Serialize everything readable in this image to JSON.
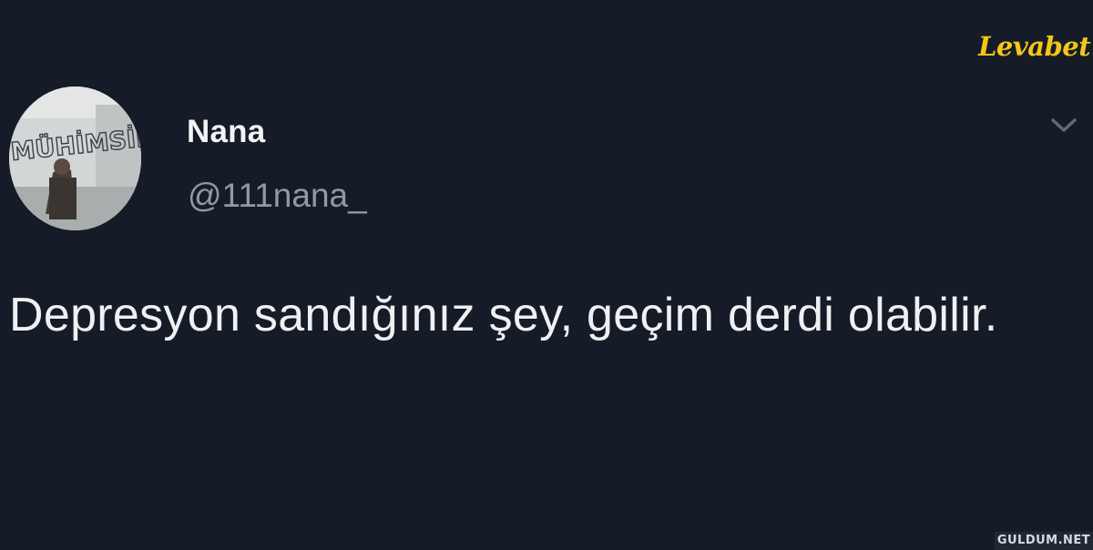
{
  "tweet": {
    "display_name": "Nana",
    "handle": "@111nana_",
    "text": "Depresyon sandığınız şey, geçim derdi olabilir."
  },
  "avatar": {
    "wall_text": "MÜHİMSİN"
  },
  "icons": {
    "menu": "chevron-down-icon"
  },
  "brand_logo": "Levabet",
  "watermark": "GULDUM.NET",
  "colors": {
    "background": "#151c27",
    "name": "#f1f3f5",
    "handle": "#8e9aa6",
    "text": "#eef0f2",
    "brand": "#f5c518"
  }
}
